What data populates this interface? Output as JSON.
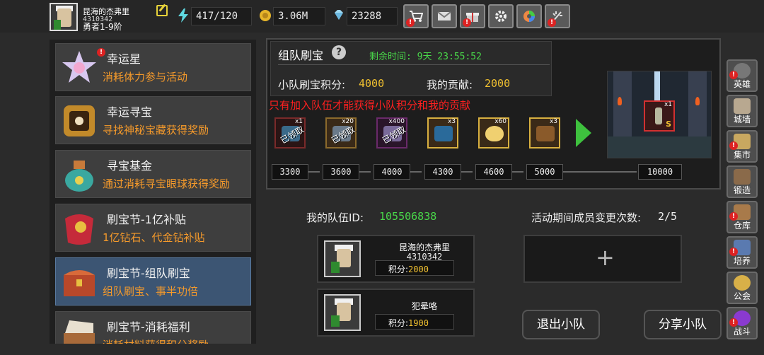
{
  "player": {
    "name": "昆海的杰弗里",
    "id": "4310342",
    "rank": "勇者1-9阶"
  },
  "resources": {
    "energy": "417/120",
    "gold": "3.06M",
    "diamonds": "23288"
  },
  "toolbar": [
    "shop-cart-icon",
    "mail-icon",
    "gift-icon",
    "settings-gear-icon",
    "color-wheel-icon",
    "firework-icon"
  ],
  "menu": [
    {
      "title": "幸运星",
      "subtitle": "消耗体力参与活动",
      "alert": "!"
    },
    {
      "title": "幸运寻宝",
      "subtitle": "寻找神秘宝藏获得奖励"
    },
    {
      "title": "寻宝基金",
      "subtitle": "通过消耗寻宝眼球获得奖励"
    },
    {
      "title": "刷宝节-1亿补贴",
      "subtitle": "1亿钻石、代金钻补贴"
    },
    {
      "title": "刷宝节-组队刷宝",
      "subtitle": "组队刷宝、事半功倍"
    },
    {
      "title": "刷宝节-消耗福利",
      "subtitle": "消耗材料获得积分奖励"
    }
  ],
  "team_event": {
    "title": "组队刷宝",
    "help": "?",
    "time_label": "剩余时间:",
    "time_value": "9天 23:55:52",
    "score_label": "小队刷宝积分:",
    "score_value": "4000",
    "contrib_label": "我的贡献:",
    "contrib_value": "2000",
    "note": "只有加入队伍才能获得小队积分和我的贡献",
    "rewards": [
      {
        "count": "x1",
        "status": "已领取"
      },
      {
        "count": "x20",
        "status": "已领取"
      },
      {
        "count": "x400",
        "status": "已领取"
      },
      {
        "count": "x3",
        "status": ""
      },
      {
        "count": "x60",
        "status": ""
      },
      {
        "count": "x3",
        "status": ""
      }
    ],
    "thresholds": [
      "3300",
      "3600",
      "4000",
      "4300",
      "4600",
      "5000",
      "10000"
    ],
    "grand_reward": {
      "count": "x1",
      "badge": "S"
    }
  },
  "team": {
    "id_label": "我的队伍ID:",
    "id_value": "105506838",
    "changes_label": "活动期间成员变更次数:",
    "changes_value": "2/5",
    "members": [
      {
        "name": "昆海的杰弗里",
        "id": "4310342",
        "score_label": "积分:",
        "score": "2000"
      },
      {
        "name": "犯晕咯",
        "id": "",
        "score_label": "积分:",
        "score": "1900"
      }
    ],
    "empty_slot": "+",
    "leave_button": "退出小队",
    "share_button": "分享小队"
  },
  "right_nav": [
    {
      "label": "英雄",
      "alert": "!"
    },
    {
      "label": "城墙"
    },
    {
      "label": "集市",
      "alert": "!"
    },
    {
      "label": "锻造"
    },
    {
      "label": "仓库",
      "alert": "!"
    },
    {
      "label": "培养",
      "alert": "!"
    },
    {
      "label": "公会"
    },
    {
      "label": "战斗",
      "alert": "!"
    }
  ],
  "colors": {
    "accent_orange": "#f59a2b",
    "accent_green": "#49d84a",
    "accent_gold": "#f0c030",
    "alert_red": "#ff2020",
    "active_blue": "#3c5573"
  }
}
